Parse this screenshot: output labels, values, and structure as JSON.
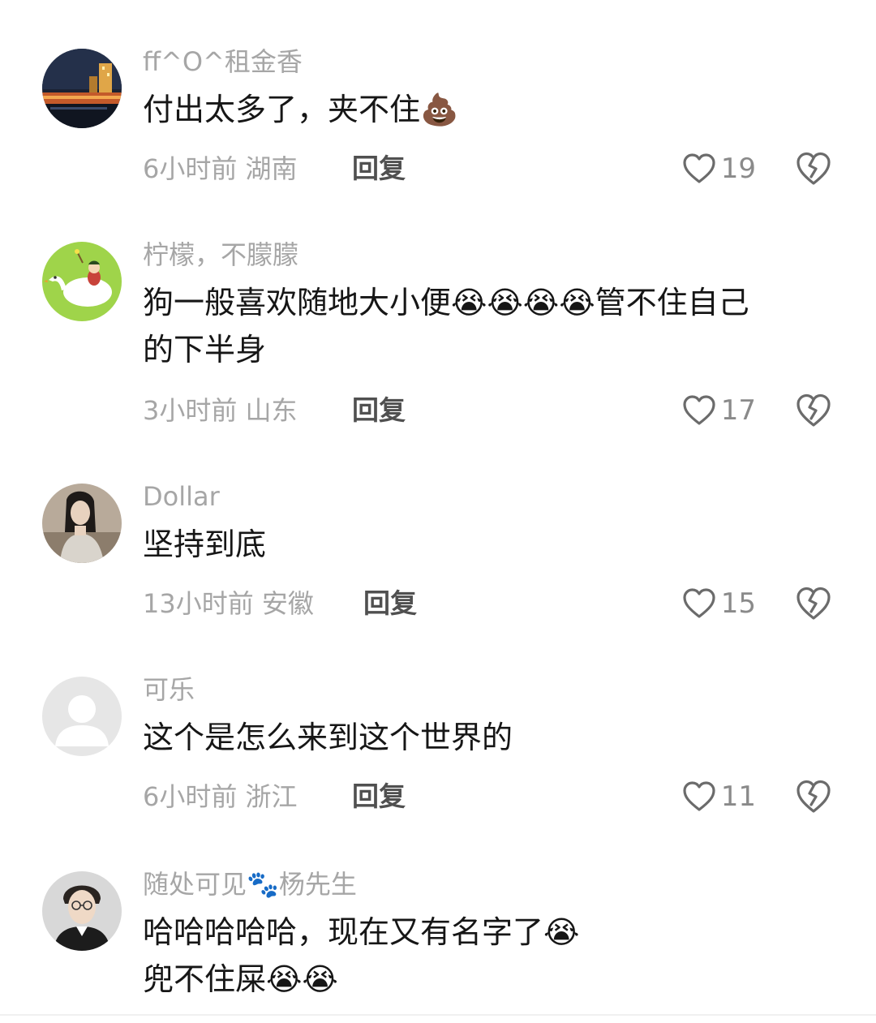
{
  "comments": [
    {
      "username": "ff^O^租金香",
      "text": "付出太多了，夹不住💩",
      "time": "6小时前",
      "location": "湖南",
      "reply_label": "回复",
      "likes": "19",
      "avatar_icon": "night-cityscape-avatar"
    },
    {
      "username": "柠檬，不朦朦",
      "text": "狗一般喜欢随地大小便😭😭😭😭管不住自己\n的下半身",
      "time": "3小时前",
      "location": "山东",
      "reply_label": "回复",
      "likes": "17",
      "avatar_icon": "goose-cartoon-avatar"
    },
    {
      "username": "Dollar",
      "text": "坚持到底",
      "time": "13小时前",
      "location": "安徽",
      "reply_label": "回复",
      "likes": "15",
      "avatar_icon": "person-photo-avatar"
    },
    {
      "username": "可乐",
      "text": "这个是怎么来到这个世界的",
      "time": "6小时前",
      "location": "浙江",
      "reply_label": "回复",
      "likes": "11",
      "avatar_icon": "default-user-avatar"
    },
    {
      "username": "随处可见🐾杨先生",
      "text": "哈哈哈哈哈，现在又有名字了😭\n兜不住屎😭😭",
      "avatar_icon": "man-with-glasses-avatar"
    }
  ],
  "colors": {
    "text": "#161616",
    "muted": "#a6a6a6",
    "reply": "#505050",
    "icon": "#6b6b6b"
  }
}
